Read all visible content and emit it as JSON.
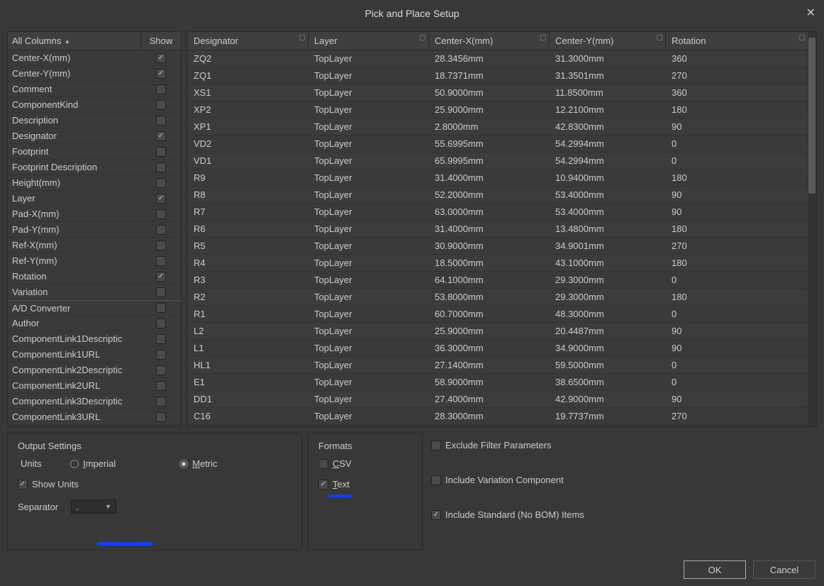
{
  "title": "Pick and Place Setup",
  "columns_panel": {
    "header_all": "All Columns",
    "header_show": "Show",
    "items": [
      {
        "name": "Center-X(mm)",
        "checked": true
      },
      {
        "name": "Center-Y(mm)",
        "checked": true
      },
      {
        "name": "Comment",
        "checked": false
      },
      {
        "name": "ComponentKind",
        "checked": false
      },
      {
        "name": "Description",
        "checked": false
      },
      {
        "name": "Designator",
        "checked": true
      },
      {
        "name": "Footprint",
        "checked": false
      },
      {
        "name": "Footprint Description",
        "checked": false
      },
      {
        "name": "Height(mm)",
        "checked": false
      },
      {
        "name": "Layer",
        "checked": true
      },
      {
        "name": "Pad-X(mm)",
        "checked": false
      },
      {
        "name": "Pad-Y(mm)",
        "checked": false
      },
      {
        "name": "Ref-X(mm)",
        "checked": false
      },
      {
        "name": "Ref-Y(mm)",
        "checked": false
      },
      {
        "name": "Rotation",
        "checked": true
      },
      {
        "name": "Variation",
        "checked": false
      },
      {
        "name": "A/D Converter",
        "checked": false
      },
      {
        "name": "Author",
        "checked": false
      },
      {
        "name": "ComponentLink1Descriptic",
        "checked": false
      },
      {
        "name": "ComponentLink1URL",
        "checked": false
      },
      {
        "name": "ComponentLink2Descriptic",
        "checked": false
      },
      {
        "name": "ComponentLink2URL",
        "checked": false
      },
      {
        "name": "ComponentLink3Descriptic",
        "checked": false
      },
      {
        "name": "ComponentLink3URL",
        "checked": false
      }
    ]
  },
  "data": {
    "headers": {
      "designator": "Designator",
      "layer": "Layer",
      "cx": "Center-X(mm)",
      "cy": "Center-Y(mm)",
      "rot": "Rotation"
    },
    "rows": [
      {
        "d": "ZQ2",
        "l": "TopLayer",
        "x": "28.3456mm",
        "y": "31.3000mm",
        "r": "360"
      },
      {
        "d": "ZQ1",
        "l": "TopLayer",
        "x": "18.7371mm",
        "y": "31.3501mm",
        "r": "270"
      },
      {
        "d": "XS1",
        "l": "TopLayer",
        "x": "50.9000mm",
        "y": "11.8500mm",
        "r": "360"
      },
      {
        "d": "XP2",
        "l": "TopLayer",
        "x": "25.9000mm",
        "y": "12.2100mm",
        "r": "180"
      },
      {
        "d": "XP1",
        "l": "TopLayer",
        "x": "2.8000mm",
        "y": "42.8300mm",
        "r": "90"
      },
      {
        "d": "VD2",
        "l": "TopLayer",
        "x": "55.6995mm",
        "y": "54.2994mm",
        "r": "0"
      },
      {
        "d": "VD1",
        "l": "TopLayer",
        "x": "65.9995mm",
        "y": "54.2994mm",
        "r": "0"
      },
      {
        "d": "R9",
        "l": "TopLayer",
        "x": "31.4000mm",
        "y": "10.9400mm",
        "r": "180"
      },
      {
        "d": "R8",
        "l": "TopLayer",
        "x": "52.2000mm",
        "y": "53.4000mm",
        "r": "90"
      },
      {
        "d": "R7",
        "l": "TopLayer",
        "x": "63.0000mm",
        "y": "53.4000mm",
        "r": "90"
      },
      {
        "d": "R6",
        "l": "TopLayer",
        "x": "31.4000mm",
        "y": "13.4800mm",
        "r": "180"
      },
      {
        "d": "R5",
        "l": "TopLayer",
        "x": "30.9000mm",
        "y": "34.9001mm",
        "r": "270"
      },
      {
        "d": "R4",
        "l": "TopLayer",
        "x": "18.5000mm",
        "y": "43.1000mm",
        "r": "180"
      },
      {
        "d": "R3",
        "l": "TopLayer",
        "x": "64.1000mm",
        "y": "29.3000mm",
        "r": "0"
      },
      {
        "d": "R2",
        "l": "TopLayer",
        "x": "53.8000mm",
        "y": "29.3000mm",
        "r": "180"
      },
      {
        "d": "R1",
        "l": "TopLayer",
        "x": "60.7000mm",
        "y": "48.3000mm",
        "r": "0"
      },
      {
        "d": "L2",
        "l": "TopLayer",
        "x": "25.9000mm",
        "y": "20.4487mm",
        "r": "90"
      },
      {
        "d": "L1",
        "l": "TopLayer",
        "x": "36.3000mm",
        "y": "34.9000mm",
        "r": "90"
      },
      {
        "d": "HL1",
        "l": "TopLayer",
        "x": "27.1400mm",
        "y": "59.5000mm",
        "r": "0"
      },
      {
        "d": "E1",
        "l": "TopLayer",
        "x": "58.9000mm",
        "y": "38.6500mm",
        "r": "0"
      },
      {
        "d": "DD1",
        "l": "TopLayer",
        "x": "27.4000mm",
        "y": "42.9000mm",
        "r": "90"
      },
      {
        "d": "C16",
        "l": "TopLayer",
        "x": "28.3000mm",
        "y": "19.7737mm",
        "r": "270"
      }
    ]
  },
  "output": {
    "title": "Output Settings",
    "units_label": "Units",
    "imperial": "Imperial",
    "metric": "Metric",
    "show_units": "Show Units",
    "separator_label": "Separator",
    "separator_value": "."
  },
  "formats": {
    "title": "Formats",
    "csv": "CSV",
    "text": "Text"
  },
  "flags": {
    "exclude": "Exclude Filter Parameters",
    "include_var": "Include Variation Component",
    "include_std": "Include Standard (No BOM) Items"
  },
  "buttons": {
    "ok": "OK",
    "cancel": "Cancel"
  }
}
